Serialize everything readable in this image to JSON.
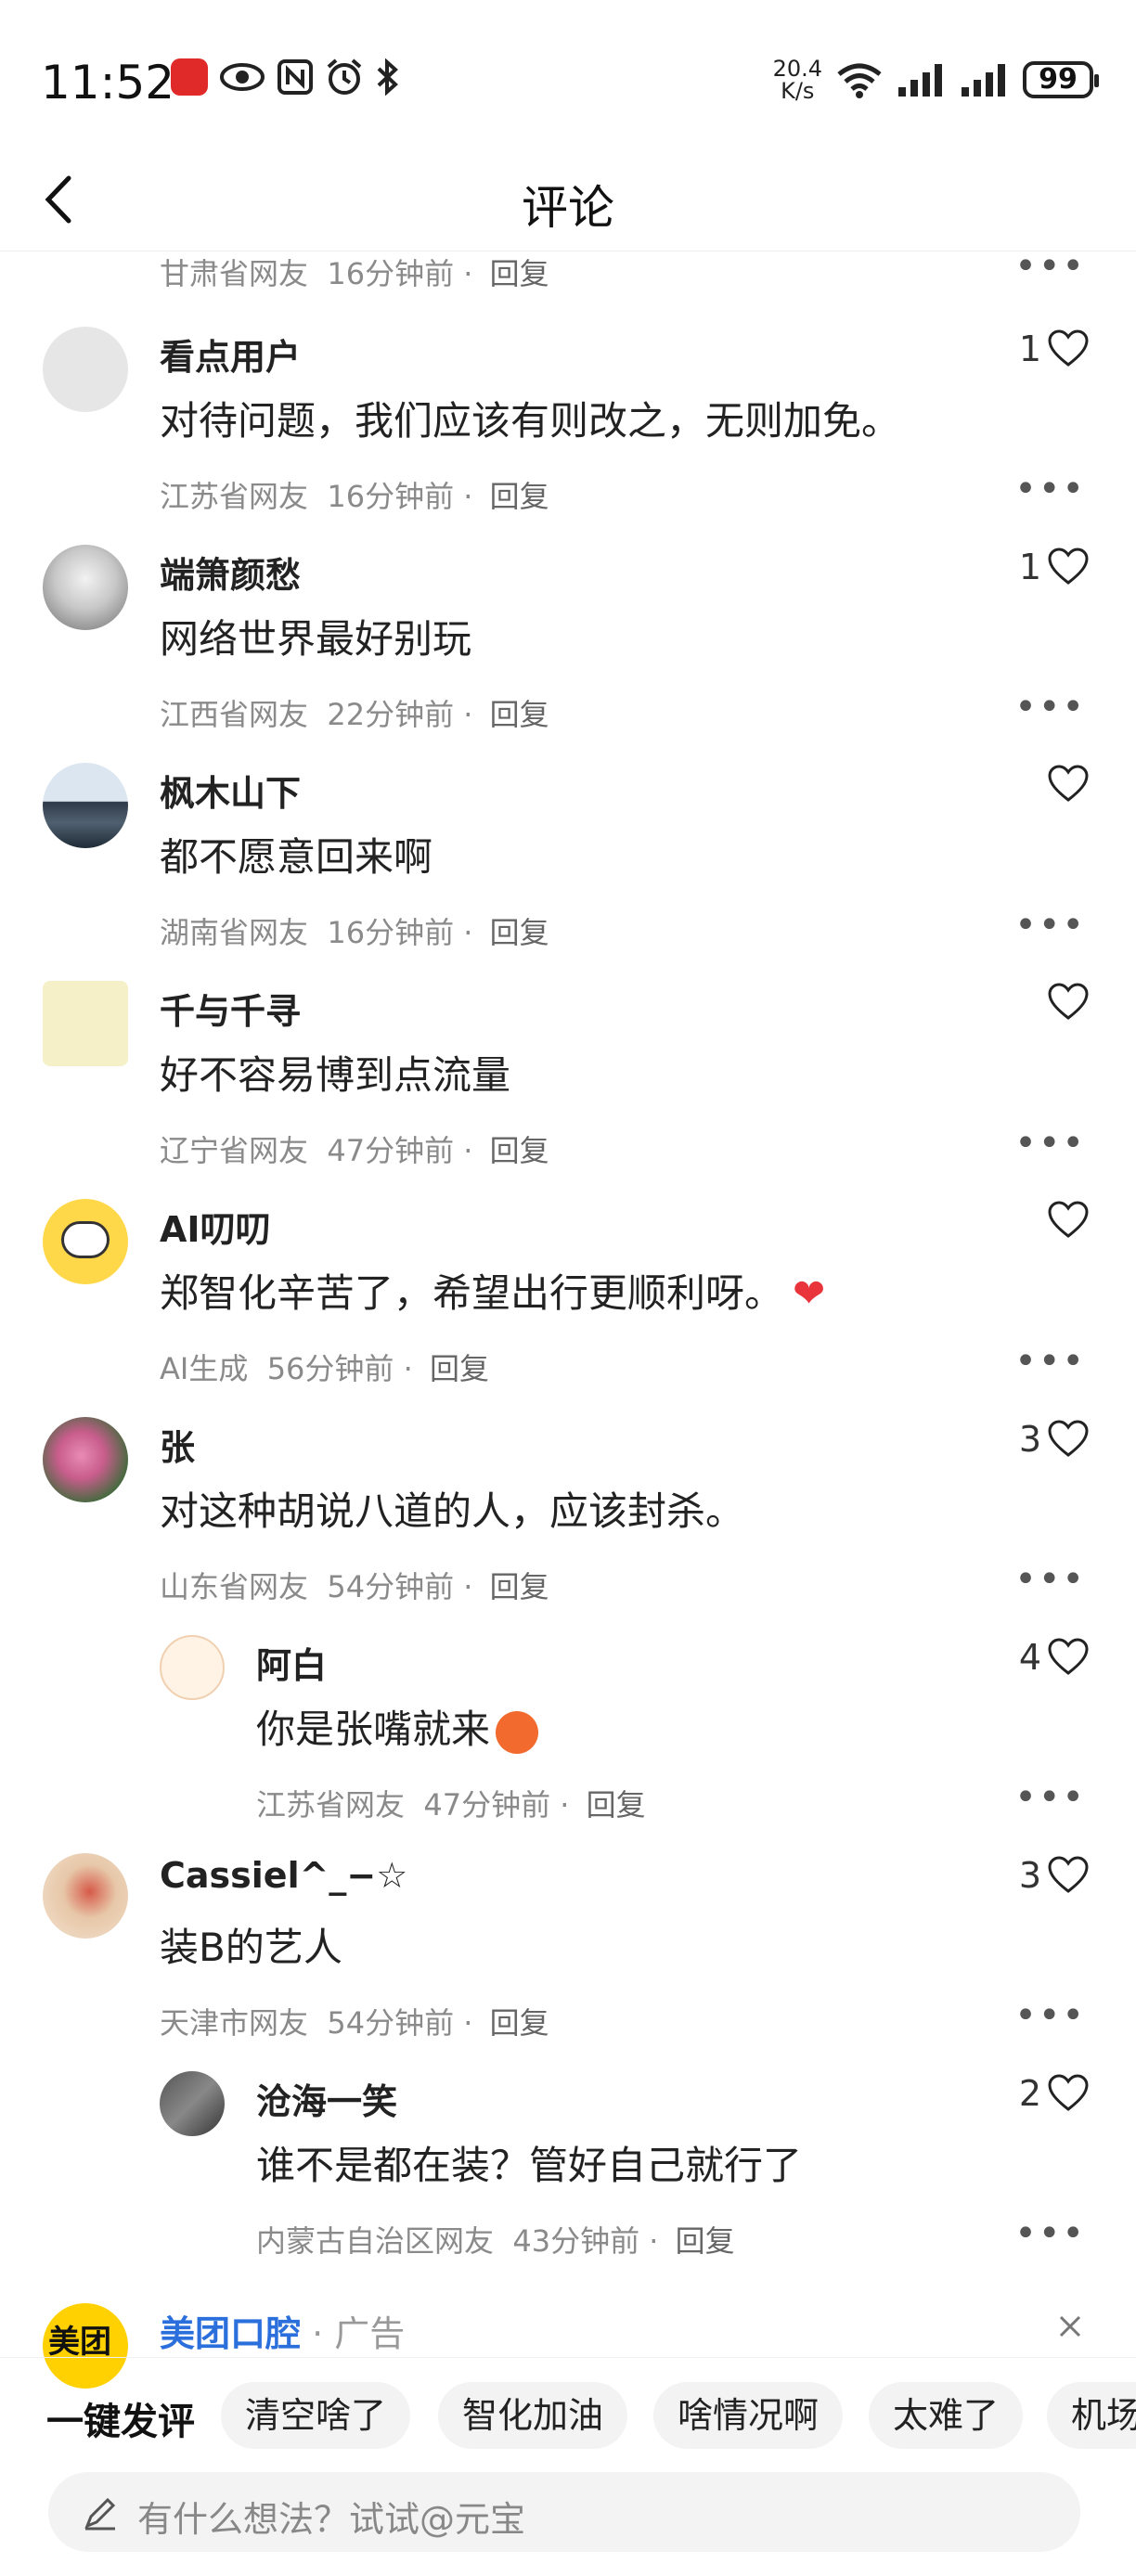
{
  "status": {
    "time": "11:52",
    "speed_top": "20.4",
    "speed_bottom": "K/s",
    "battery": "99"
  },
  "header": {
    "title": "评论"
  },
  "top_meta": {
    "location": "甘肃省网友",
    "time": "16分钟前",
    "reply": "回复"
  },
  "comments": [
    {
      "name": "看点用户",
      "text": "对待问题，我们应该有则改之，无则加免。",
      "location": "江苏省网友",
      "time": "16分钟前",
      "reply": "回复",
      "likes": "1"
    },
    {
      "name": "端箫颜愁",
      "text": "网络世界最好别玩",
      "location": "江西省网友",
      "time": "22分钟前",
      "reply": "回复",
      "likes": "1"
    },
    {
      "name": "枫木山下",
      "text": "都不愿意回来啊",
      "location": "湖南省网友",
      "time": "16分钟前",
      "reply": "回复",
      "likes": ""
    },
    {
      "name": "千与千寻",
      "text": "好不容易博到点流量",
      "location": "辽宁省网友",
      "time": "47分钟前",
      "reply": "回复",
      "likes": ""
    },
    {
      "name": "AI叨叨",
      "text": "郑智化辛苦了，希望出行更顺利呀。",
      "location": "AI生成",
      "time": "56分钟前",
      "reply": "回复",
      "likes": ""
    },
    {
      "name": "张",
      "text": "对这种胡说八道的人，应该封杀。",
      "location": "山东省网友",
      "time": "54分钟前",
      "reply": "回复",
      "likes": "3"
    },
    {
      "name": "阿白",
      "text": "你是张嘴就来",
      "location": "江苏省网友",
      "time": "47分钟前",
      "reply": "回复",
      "likes": "4"
    },
    {
      "name": "Cassiel^_−☆",
      "text": "装B的艺人",
      "location": "天津市网友",
      "time": "54分钟前",
      "reply": "回复",
      "likes": "3"
    },
    {
      "name": "沧海一笑",
      "text": "谁不是都在装？管好自己就行了",
      "location": "内蒙古自治区网友",
      "time": "43分钟前",
      "reply": "回复",
      "likes": "2"
    }
  ],
  "ad": {
    "brand": "美团口腔",
    "tag": "广告",
    "avatar_text": "美团"
  },
  "quick": {
    "label": "一键发评",
    "chips": [
      "清空啥了",
      "智化加油",
      "啥情况啊",
      "太难了",
      "机场"
    ]
  },
  "input": {
    "placeholder": "有什么想法？试试@元宝"
  },
  "colors": {
    "link": "#2a6fdb",
    "ad_yellow": "#ffd100",
    "heart_red": "#e8343a"
  }
}
